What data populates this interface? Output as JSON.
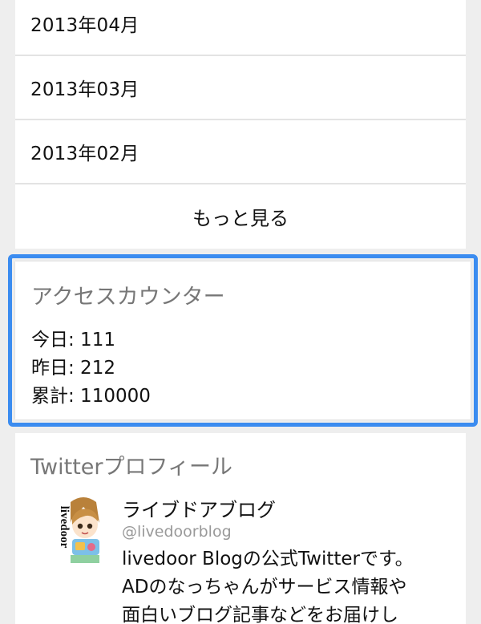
{
  "archive": {
    "items": [
      {
        "label": "2013年04月"
      },
      {
        "label": "2013年03月"
      },
      {
        "label": "2013年02月"
      }
    ],
    "more_label": "もっと見る"
  },
  "counter": {
    "title": "アクセスカウンター",
    "today": "今日: 111",
    "yesterday": "昨日: 212",
    "total": "累計: 110000",
    "highlight_color": "#3b8cf0"
  },
  "twitter": {
    "title": "Twitterプロフィール",
    "avatar_text": "livedoor",
    "name": "ライブドアブログ",
    "handle": "@livedoorblog",
    "description_lines": [
      "livedoor Blogの公式Twitterです。",
      "ADのなっちゃんがサービス情報や",
      "面白いブログ記事などをお届けし"
    ]
  }
}
